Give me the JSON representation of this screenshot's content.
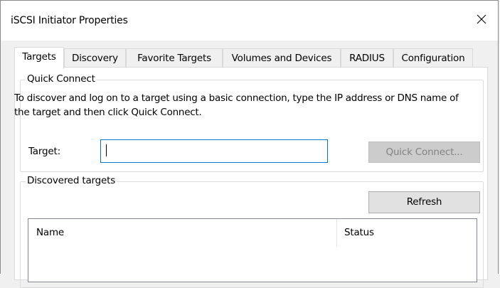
{
  "window": {
    "title": "iSCSI Initiator Properties"
  },
  "tabs": [
    {
      "label": "Targets",
      "active": true
    },
    {
      "label": "Discovery",
      "active": false
    },
    {
      "label": "Favorite Targets",
      "active": false
    },
    {
      "label": "Volumes and Devices",
      "active": false
    },
    {
      "label": "RADIUS",
      "active": false
    },
    {
      "label": "Configuration",
      "active": false
    }
  ],
  "quick_connect": {
    "group_title": "Quick Connect",
    "description": "To discover and log on to a target using a basic connection, type the IP address or DNS name of the target and then click Quick Connect.",
    "target_label": "Target:",
    "target_value": "",
    "button_label": "Quick Connect..."
  },
  "discovered": {
    "group_title": "Discovered targets",
    "refresh_label": "Refresh",
    "columns": [
      "Name",
      "Status"
    ]
  },
  "icons": {
    "close": "close-icon"
  },
  "colors": {
    "focus_border": "#0078d7",
    "disabled_text": "#838383"
  }
}
